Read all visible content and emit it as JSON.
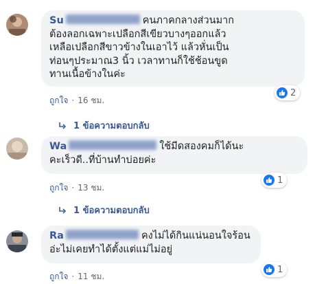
{
  "comments": [
    {
      "author_visible": "Su",
      "text": "คนภาคกลางส่วนมากต้องลอกเฉพาะเปลือกสีเขียวบางๆออกแล้วเหลือเปลือกสีขาวข้างในเอาไว้ แล้วหั่นเป็นท่อนๆประมาณ3 นิ้ว เวลาทานก็ใช้ช้อนขูดทานเนื้อข้างในค่ะ",
      "lines": [
        "ต้องลอกเฉพาะเปลือกสีเขียวบางๆออกแล้ว",
        "เหลือเปลือกสีขาวข้างในเอาไว้ แล้วหั่นเป็น",
        "ท่อนๆประมาณ3 นิ้ว เวลาทานก็ใช้ช้อนขูด",
        "ทานเนื้อข้างในค่ะ"
      ],
      "first_line": "คนภาคกลางส่วนมาก",
      "reaction_count": "2",
      "like_label": "ถูกใจ",
      "separator": "·",
      "time": "16 ชม.",
      "replies_label": "1 ข้อความตอบกลับ"
    },
    {
      "author_visible": "Wa",
      "first_line": "ใช้มีดสองคมก็ได้นะ",
      "lines": [
        "คะเร็วดี..ที่บ้านทำบ่อยค่ะ"
      ],
      "reaction_count": "1",
      "like_label": "ถูกใจ",
      "separator": "·",
      "time": "13 ชม.",
      "replies_label": "1 ข้อความตอบกลับ"
    },
    {
      "author_visible": "Ra",
      "first_line": "คงไม่ได้กินแน่นอนใจร้อน",
      "lines": [
        "อ่ะไม่เคยทำได้ตั้งแต่แม่ไม่อยู่"
      ],
      "reaction_count": "1",
      "like_label": "ถูกใจ",
      "separator": "·",
      "time": "11 ชม."
    }
  ],
  "colors": {
    "link": "#385898",
    "bubble": "#f2f3f5",
    "like_blue": "#1877f2",
    "meta": "#606770"
  },
  "icons": {
    "reaction": "thumbs-up-icon",
    "reply": "reply-arrow-icon"
  }
}
